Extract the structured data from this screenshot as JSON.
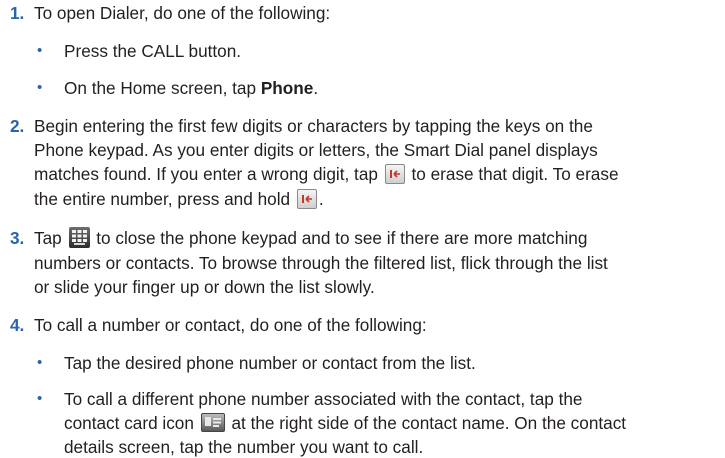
{
  "step1": {
    "number": "1.",
    "text": "To open Dialer, do one of the following:",
    "bullet1": "Press the CALL button.",
    "bullet2_pre": "On the Home screen, tap ",
    "bullet2_bold": "Phone",
    "bullet2_post": "."
  },
  "step2": {
    "number": "2.",
    "line1": "Begin entering the first few digits or characters by tapping the keys on the",
    "line2": "Phone keypad. As you enter digits or letters, the Smart Dial panel displays",
    "line3_pre": "matches found. If you enter a wrong digit, tap ",
    "line3_post": " to erase that digit. To erase",
    "line4_pre": "the entire number, press and hold ",
    "line4_post": "."
  },
  "step3": {
    "number": "3.",
    "line1_pre": "Tap ",
    "line1_post": " to close the phone keypad and to see if there are more matching",
    "line2": "numbers or contacts. To browse through the filtered list, flick through the list",
    "line3": "or slide your finger up or down the list slowly."
  },
  "step4": {
    "number": "4.",
    "text": "To call a number or contact, do one of the following:",
    "bullet1": "Tap the desired phone number or contact from the list.",
    "bullet2_line1": "To call a different phone number associated with the contact, tap the",
    "bullet2_line2_pre": "contact card icon ",
    "bullet2_line2_post": " at the right side of the contact name. On the contact",
    "bullet2_line3": "details screen, tap the number you want to call."
  },
  "icons": {
    "backspace": "backspace-icon",
    "keypad": "keypad-icon",
    "contact_card": "contact-card-icon"
  },
  "colors": {
    "accent": "#2b63a8",
    "text": "#231f20"
  }
}
